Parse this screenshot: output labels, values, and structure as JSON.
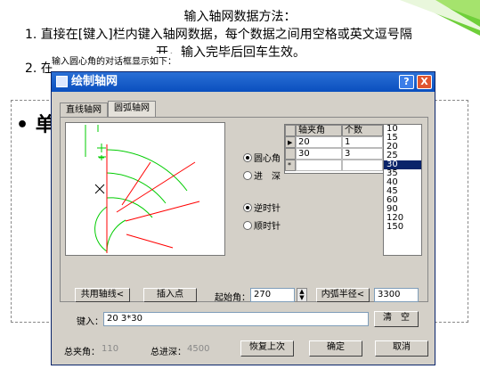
{
  "slide": {
    "heading": "输入轴网数据方法：",
    "line1": "1. 直接在[键入]栏内键入轴网数据，每个数据之间用空格或英文逗号隔",
    "line1_cont": "开，输入完毕后回车生效。",
    "line2": "2. 在",
    "caption": "输入圆心角的对话框显示如下：",
    "bullet": "• 单"
  },
  "dialog": {
    "title": "绘制轴网",
    "help_label": "?",
    "close_label": "X",
    "tabs": [
      "直线轴网",
      "圆弧轴网"
    ],
    "active_tab": 1,
    "radios": {
      "center_angle": "圆心角",
      "depth": "进　深",
      "counterclockwise": "逆时针",
      "clockwise": "顺时针"
    },
    "grid": {
      "headers": [
        "轴夹角",
        "个数"
      ],
      "rows": [
        [
          "20",
          "1"
        ],
        [
          "30",
          "3"
        ],
        [
          "",
          ""
        ]
      ]
    },
    "angle_list": [
      "10",
      "15",
      "20",
      "25",
      "30",
      "35",
      "40",
      "45",
      "60",
      "90",
      "120",
      "150"
    ],
    "selected_angle": "30",
    "shared_axis_button": "共用轴线<",
    "insert_point_button": "插入点",
    "start_angle_label": "起始角：",
    "start_angle_value": "270",
    "inner_radius_button": "内弧半径<",
    "inner_radius_value": "3300",
    "input_label": "键入：",
    "input_value": "20 3*30",
    "clear_button": "清　空",
    "total_angle_label": "总夹角：",
    "total_angle_value": "110",
    "total_depth_label": "总进深：",
    "total_depth_value": "4500",
    "restore_button": "恢复上次",
    "ok_button": "确定",
    "cancel_button": "取消",
    "colors": {
      "arc": "#00cc00",
      "axis": "#ff0000",
      "titlebar": "#0a4fbe"
    }
  }
}
